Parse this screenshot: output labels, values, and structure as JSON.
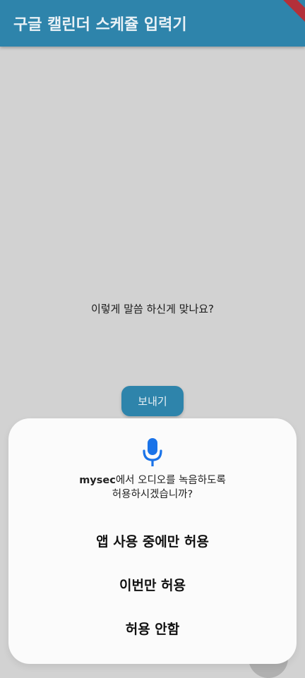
{
  "appbar": {
    "title": "구글 캘린더 스케쥴 입력기"
  },
  "main": {
    "question": "이렇게 말씀 하신게 맞나요?",
    "send_label": "보내기"
  },
  "dialog": {
    "icon": "microphone-icon",
    "app_name": "mysec",
    "message_line1_rest": "에서 오디오를 녹음하도록",
    "message_line2": "허용하시겠습니까?",
    "options": [
      {
        "label": "앱 사용 중에만 허용"
      },
      {
        "label": "이번만 허용"
      },
      {
        "label": "허용 안함"
      }
    ]
  },
  "colors": {
    "appbar": "#2e84ab",
    "background": "#d2d2d2",
    "dialog": "#fbfbfb",
    "mic_accent": "#1a73e8"
  }
}
